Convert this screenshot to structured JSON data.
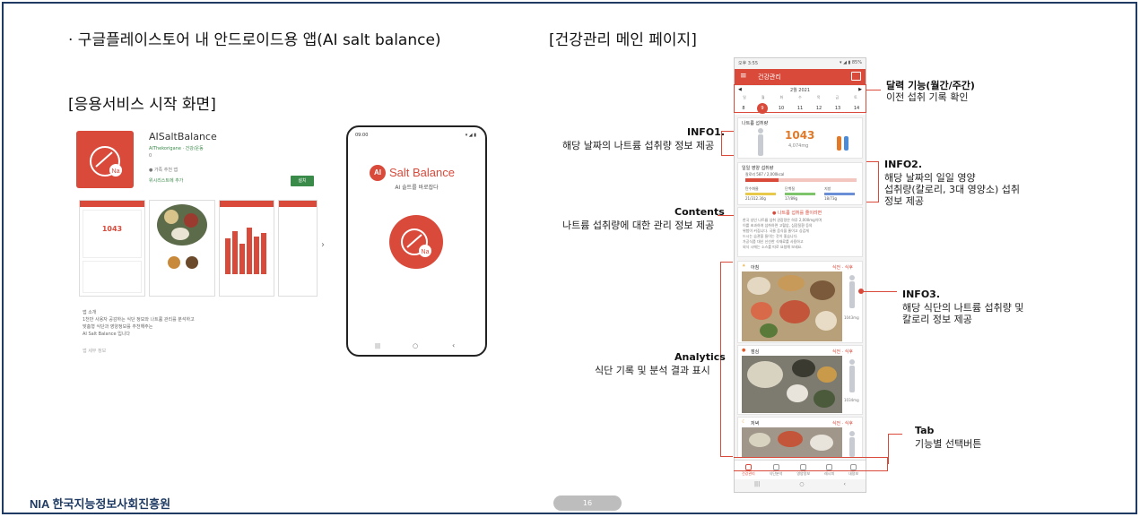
{
  "slide": {
    "heading_left": "· 구글플레이스토어 내 안드로이드용 앱(AI salt balance)",
    "heading_right": "[건강관리 메인 페이지]",
    "subheading": "[응용서비스 시작 화면]",
    "page_number": "16",
    "footer_logo": "NIA 한국지능정보사회진흥원"
  },
  "store": {
    "app_name": "AISaltBalance",
    "developer": "AIThekorigane · 건강/운동",
    "rating": "0",
    "notice": "● 가족 추천 앱",
    "wishlist": "위시리스트에 추가",
    "install": "설치",
    "desc_lines": [
      "앱 소개",
      "1천만 사용자 공감하는 식단 정보와 나트륨 관리를 분석하고",
      "맞춤형 식단과 영양정보를 추천해주는",
      "AI Salt Balance 입니다"
    ],
    "footer_text": "앱 세부 정보",
    "sodium_value": "1043",
    "nav_arrow": "›"
  },
  "splash": {
    "status_time": "09:00",
    "status_icons": "▾ ◢ ▮",
    "logo_ai": "AI",
    "logo_text": "Salt Balance",
    "tagline": "AI 솔트를 바로잡다",
    "nav_left": "|||",
    "nav_mid": "○",
    "nav_right": "‹"
  },
  "phone": {
    "status_time": "오후 3:55",
    "status_icons": "▾ ◢ ▮ 85%",
    "header_title": "건강관리",
    "menu_icon": "≡",
    "month": "2월 2021",
    "weekdays": [
      "일",
      "월",
      "화",
      "수",
      "목",
      "금",
      "토"
    ],
    "days": [
      "8",
      "9",
      "10",
      "11",
      "12",
      "13",
      "14"
    ],
    "selected_day_index": 1,
    "sodium_card_title": "나트륨 섭취량",
    "sodium_value": "1043",
    "sodium_sub": "4,074mg",
    "nutrition_title": "일일 영양 섭취량",
    "nutrition_kcal": "칼로리 587 / 2,000kcal",
    "nutrients": [
      {
        "name": "탄수화물",
        "value": "21/312.30g"
      },
      {
        "name": "단백질",
        "value": "17/89g"
      },
      {
        "name": "지방",
        "value": "18/73g"
      }
    ],
    "info_button": "● 나트륨 섭취를 줄이려면",
    "info_text": [
      "한국 성인 나트륨 섭취 권장량은 하루 2,000mg이며",
      "이를 초과하여 섭취하면 고혈압, 심장질환 등의",
      "위험이 커집니다. 국물 음식을 줄이고 싱겁게",
      "드시는 습관을 들이는 것이 좋습니다.",
      "가공식품 대신 신선한 식재료를 사용하고",
      "외식 시에는 소스를 따로 요청해 보세요."
    ],
    "meals": [
      {
        "label": "아침",
        "tags": "식전 · 식후"
      },
      {
        "label": "점심",
        "tags": "식전 · 식후"
      },
      {
        "label": "저녁",
        "tags": "식전 · 식후"
      }
    ],
    "meal_side_values": [
      "1043mg",
      "1034mg",
      "300mg"
    ],
    "tabs": [
      "건강관리",
      "식단분석",
      "영양정보",
      "레시피",
      "내정보"
    ],
    "nav": [
      "|||",
      "○",
      "‹"
    ]
  },
  "annotations": {
    "calendar_title": "달력 기능(월간/주간)",
    "calendar_desc": "이전 섭취 기록 확인",
    "info1_title": "INFO1.",
    "info1_desc": "해당 날짜의 나트륨 섭취량 정보 제공",
    "info2_title": "INFO2.",
    "info2_line1": "해당 날짜의 일일 영양",
    "info2_line2": "섭취량(칼로리, 3대 영양소) 섭취",
    "info2_line3": "정보 제공",
    "contents_title": "Contents",
    "contents_desc": "나트륨 섭취량에 대한 관리 정보 제공",
    "info3_title": "INFO3.",
    "info3_line1": "해당 식단의 나트륨 섭취량 및",
    "info3_line2": "칼로리 정보 제공",
    "analytics_title": "Analytics",
    "analytics_desc": "식단 기록 및 분석 결과 표시",
    "tab_title": "Tab",
    "tab_desc": "기능별 선택버튼"
  },
  "colors": {
    "accent": "#d94a3b",
    "border": "#1f3b63",
    "nutrient_bars": [
      "#e8c94a",
      "#7ec46a",
      "#6b8fd6"
    ]
  }
}
